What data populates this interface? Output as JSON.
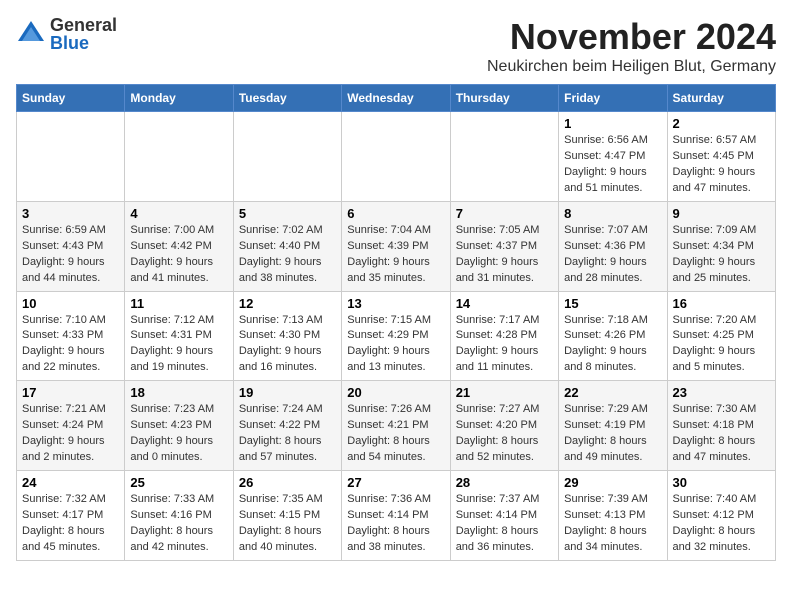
{
  "header": {
    "logo_general": "General",
    "logo_blue": "Blue",
    "month_title": "November 2024",
    "location": "Neukirchen beim Heiligen Blut, Germany"
  },
  "weekdays": [
    "Sunday",
    "Monday",
    "Tuesday",
    "Wednesday",
    "Thursday",
    "Friday",
    "Saturday"
  ],
  "weeks": [
    {
      "row_class": "row-odd",
      "days": [
        {
          "num": "",
          "detail": ""
        },
        {
          "num": "",
          "detail": ""
        },
        {
          "num": "",
          "detail": ""
        },
        {
          "num": "",
          "detail": ""
        },
        {
          "num": "",
          "detail": ""
        },
        {
          "num": "1",
          "detail": "Sunrise: 6:56 AM\nSunset: 4:47 PM\nDaylight: 9 hours and 51 minutes."
        },
        {
          "num": "2",
          "detail": "Sunrise: 6:57 AM\nSunset: 4:45 PM\nDaylight: 9 hours and 47 minutes."
        }
      ]
    },
    {
      "row_class": "row-even",
      "days": [
        {
          "num": "3",
          "detail": "Sunrise: 6:59 AM\nSunset: 4:43 PM\nDaylight: 9 hours and 44 minutes."
        },
        {
          "num": "4",
          "detail": "Sunrise: 7:00 AM\nSunset: 4:42 PM\nDaylight: 9 hours and 41 minutes."
        },
        {
          "num": "5",
          "detail": "Sunrise: 7:02 AM\nSunset: 4:40 PM\nDaylight: 9 hours and 38 minutes."
        },
        {
          "num": "6",
          "detail": "Sunrise: 7:04 AM\nSunset: 4:39 PM\nDaylight: 9 hours and 35 minutes."
        },
        {
          "num": "7",
          "detail": "Sunrise: 7:05 AM\nSunset: 4:37 PM\nDaylight: 9 hours and 31 minutes."
        },
        {
          "num": "8",
          "detail": "Sunrise: 7:07 AM\nSunset: 4:36 PM\nDaylight: 9 hours and 28 minutes."
        },
        {
          "num": "9",
          "detail": "Sunrise: 7:09 AM\nSunset: 4:34 PM\nDaylight: 9 hours and 25 minutes."
        }
      ]
    },
    {
      "row_class": "row-odd",
      "days": [
        {
          "num": "10",
          "detail": "Sunrise: 7:10 AM\nSunset: 4:33 PM\nDaylight: 9 hours and 22 minutes."
        },
        {
          "num": "11",
          "detail": "Sunrise: 7:12 AM\nSunset: 4:31 PM\nDaylight: 9 hours and 19 minutes."
        },
        {
          "num": "12",
          "detail": "Sunrise: 7:13 AM\nSunset: 4:30 PM\nDaylight: 9 hours and 16 minutes."
        },
        {
          "num": "13",
          "detail": "Sunrise: 7:15 AM\nSunset: 4:29 PM\nDaylight: 9 hours and 13 minutes."
        },
        {
          "num": "14",
          "detail": "Sunrise: 7:17 AM\nSunset: 4:28 PM\nDaylight: 9 hours and 11 minutes."
        },
        {
          "num": "15",
          "detail": "Sunrise: 7:18 AM\nSunset: 4:26 PM\nDaylight: 9 hours and 8 minutes."
        },
        {
          "num": "16",
          "detail": "Sunrise: 7:20 AM\nSunset: 4:25 PM\nDaylight: 9 hours and 5 minutes."
        }
      ]
    },
    {
      "row_class": "row-even",
      "days": [
        {
          "num": "17",
          "detail": "Sunrise: 7:21 AM\nSunset: 4:24 PM\nDaylight: 9 hours and 2 minutes."
        },
        {
          "num": "18",
          "detail": "Sunrise: 7:23 AM\nSunset: 4:23 PM\nDaylight: 9 hours and 0 minutes."
        },
        {
          "num": "19",
          "detail": "Sunrise: 7:24 AM\nSunset: 4:22 PM\nDaylight: 8 hours and 57 minutes."
        },
        {
          "num": "20",
          "detail": "Sunrise: 7:26 AM\nSunset: 4:21 PM\nDaylight: 8 hours and 54 minutes."
        },
        {
          "num": "21",
          "detail": "Sunrise: 7:27 AM\nSunset: 4:20 PM\nDaylight: 8 hours and 52 minutes."
        },
        {
          "num": "22",
          "detail": "Sunrise: 7:29 AM\nSunset: 4:19 PM\nDaylight: 8 hours and 49 minutes."
        },
        {
          "num": "23",
          "detail": "Sunrise: 7:30 AM\nSunset: 4:18 PM\nDaylight: 8 hours and 47 minutes."
        }
      ]
    },
    {
      "row_class": "row-odd",
      "days": [
        {
          "num": "24",
          "detail": "Sunrise: 7:32 AM\nSunset: 4:17 PM\nDaylight: 8 hours and 45 minutes."
        },
        {
          "num": "25",
          "detail": "Sunrise: 7:33 AM\nSunset: 4:16 PM\nDaylight: 8 hours and 42 minutes."
        },
        {
          "num": "26",
          "detail": "Sunrise: 7:35 AM\nSunset: 4:15 PM\nDaylight: 8 hours and 40 minutes."
        },
        {
          "num": "27",
          "detail": "Sunrise: 7:36 AM\nSunset: 4:14 PM\nDaylight: 8 hours and 38 minutes."
        },
        {
          "num": "28",
          "detail": "Sunrise: 7:37 AM\nSunset: 4:14 PM\nDaylight: 8 hours and 36 minutes."
        },
        {
          "num": "29",
          "detail": "Sunrise: 7:39 AM\nSunset: 4:13 PM\nDaylight: 8 hours and 34 minutes."
        },
        {
          "num": "30",
          "detail": "Sunrise: 7:40 AM\nSunset: 4:12 PM\nDaylight: 8 hours and 32 minutes."
        }
      ]
    }
  ]
}
